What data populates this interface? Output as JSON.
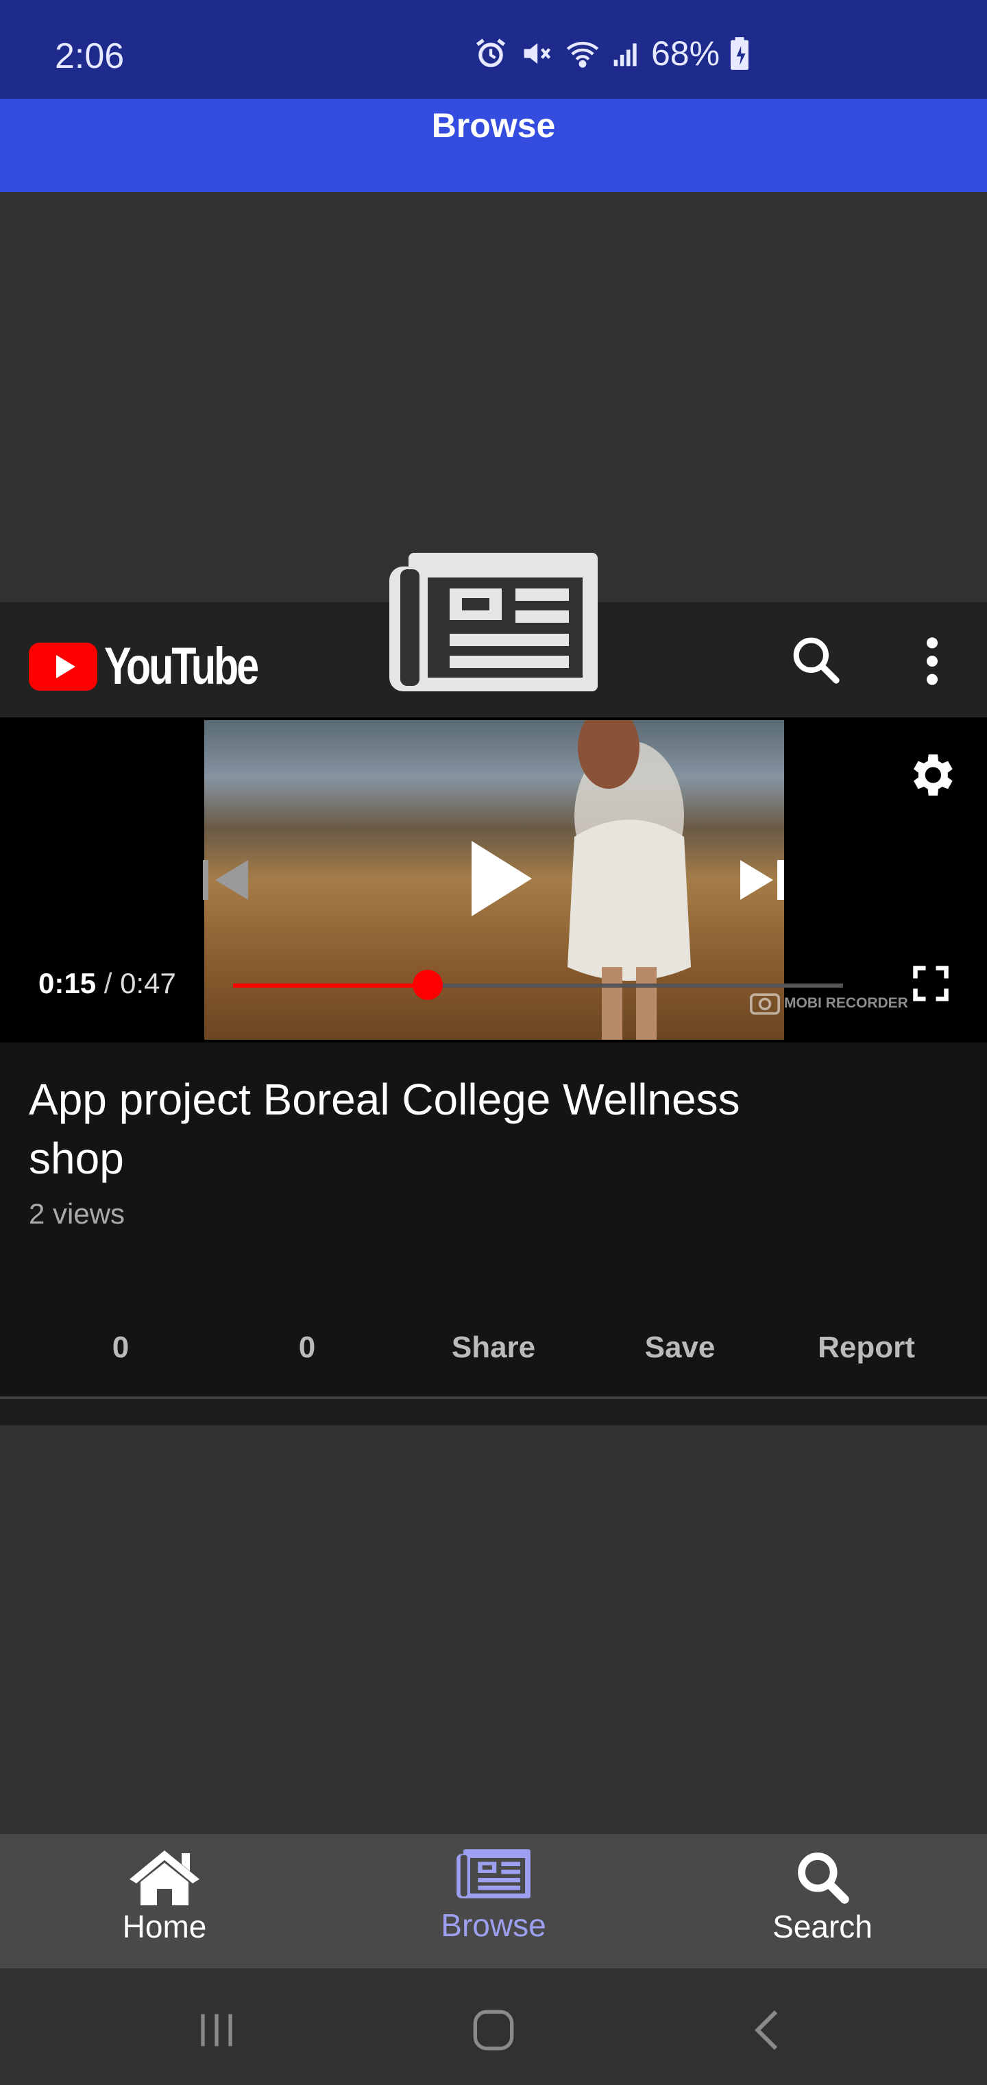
{
  "status_bar": {
    "time": "2:06",
    "battery": "68%",
    "icons": [
      "alarm-icon",
      "mute-icon",
      "wifi-icon",
      "signal-icon",
      "battery-icon"
    ]
  },
  "app_bar": {
    "title": "Browse"
  },
  "youtube": {
    "logo_text": "YouTube",
    "player": {
      "current_time": "0:15",
      "separator": "/",
      "duration": "0:47",
      "progress": 0.319,
      "watermark": "MOBI RECORDER"
    },
    "video": {
      "title": "App project Boreal College Wellness shop",
      "views": "2 views"
    },
    "actions": [
      {
        "label": "0",
        "icon": "like-icon"
      },
      {
        "label": "0",
        "icon": "dislike-icon"
      },
      {
        "label": "Share",
        "icon": "share-icon"
      },
      {
        "label": "Save",
        "icon": "save-icon"
      },
      {
        "label": "Report",
        "icon": "report-icon"
      }
    ]
  },
  "bottom_nav": {
    "items": [
      {
        "label": "Home",
        "icon": "home-icon",
        "active": false
      },
      {
        "label": "Browse",
        "icon": "newspaper-icon",
        "active": true
      },
      {
        "label": "Search",
        "icon": "search-icon",
        "active": false
      }
    ]
  },
  "colors": {
    "status_bar": "#1f2b8c",
    "app_bar": "#354ddf",
    "active_nav": "#9d9ff0",
    "progress": "#ff0000",
    "youtube_red": "#ff0000"
  }
}
